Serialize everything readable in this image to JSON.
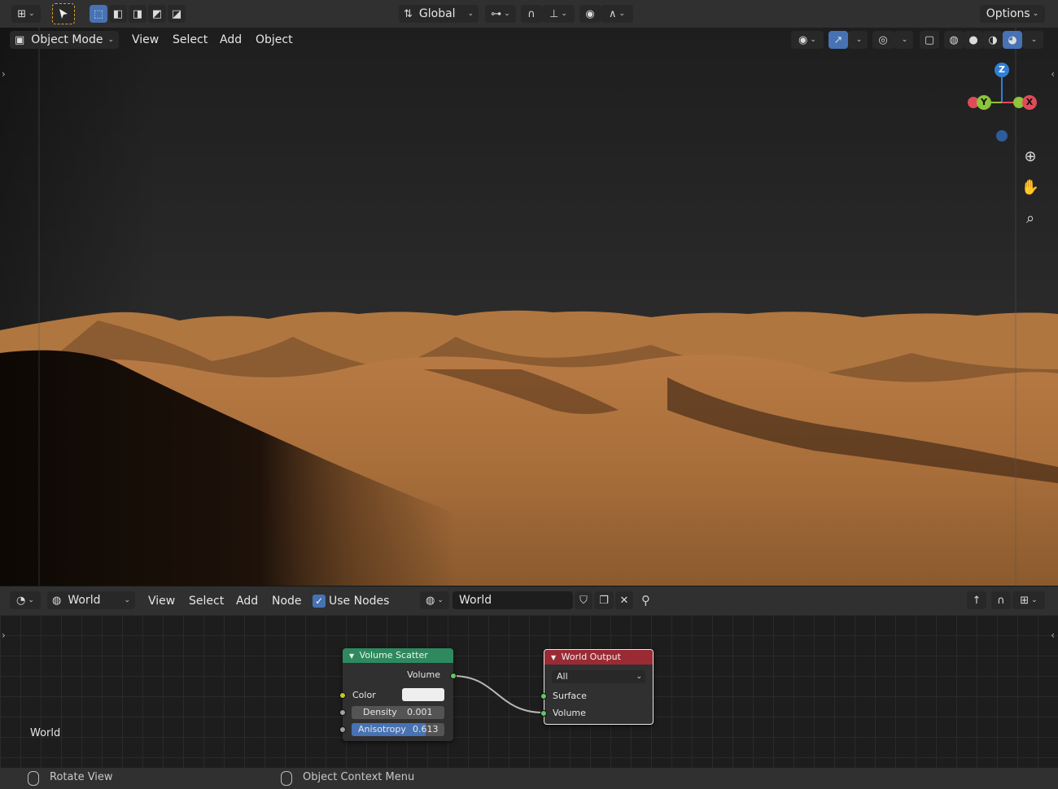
{
  "topbar": {
    "orientation": "Global",
    "options": "Options"
  },
  "viewport_header": {
    "mode": "Object Mode",
    "menu": [
      "View",
      "Select",
      "Add",
      "Object"
    ]
  },
  "gizmo": {
    "z": "Z",
    "y": "Y",
    "x": "X"
  },
  "node_editor": {
    "world_type": "World",
    "menu": [
      "View",
      "Select",
      "Add",
      "Node"
    ],
    "use_nodes_label": "Use Nodes",
    "use_nodes_checked": true,
    "world_name": "World"
  },
  "nodes": {
    "volume_scatter": {
      "title": "Volume Scatter",
      "output": "Volume",
      "color_label": "Color",
      "density_label": "Density",
      "density_value": "0.001",
      "anisotropy_label": "Anisotropy",
      "anisotropy_value": "0.613"
    },
    "world_output": {
      "title": "World Output",
      "target": "All",
      "surface": "Surface",
      "volume": "Volume"
    }
  },
  "canvas_label": "World",
  "status": {
    "left": "Rotate View",
    "right": "Object Context Menu"
  },
  "colors": {
    "sand": "#a86e3a",
    "shader_node": "#2e8a5e",
    "output_node": "#9a2b35",
    "accent_blue": "#4772b3"
  }
}
